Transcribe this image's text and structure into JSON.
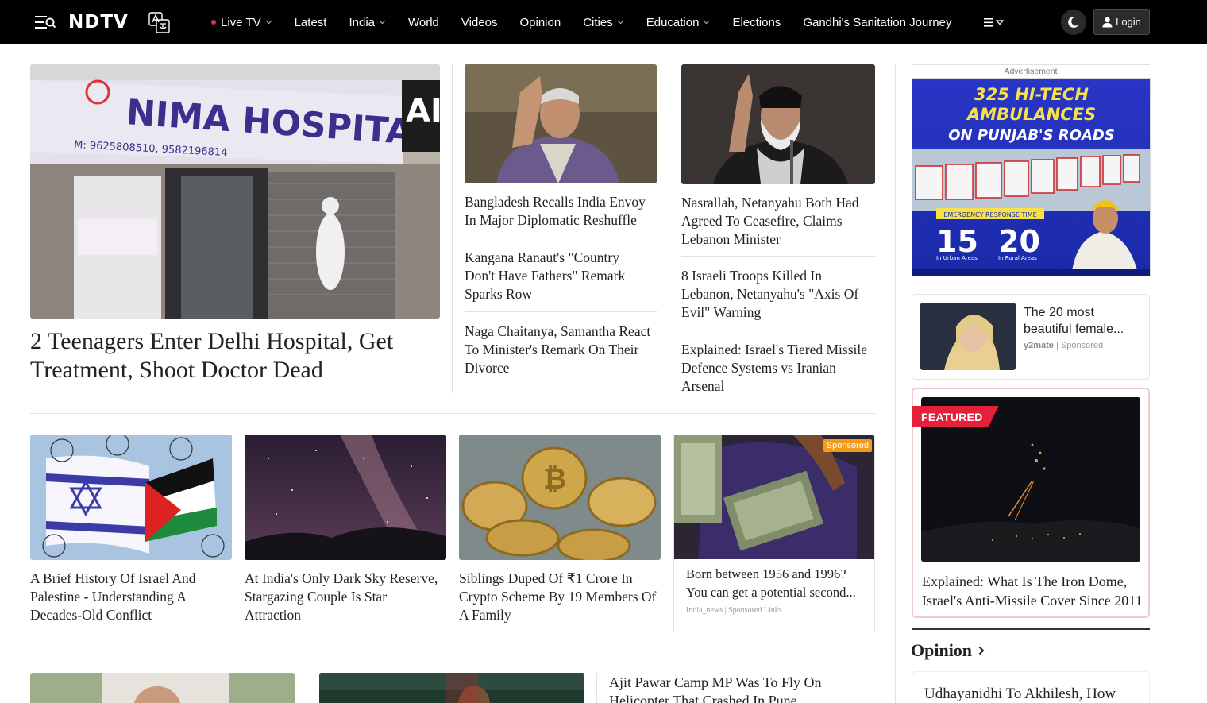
{
  "nav": {
    "logo": "NDTV",
    "links": [
      {
        "label": "Live TV",
        "dot": true,
        "chevron": true
      },
      {
        "label": "Latest",
        "chevron": false
      },
      {
        "label": "India",
        "chevron": true
      },
      {
        "label": "World",
        "chevron": false
      },
      {
        "label": "Videos",
        "chevron": false
      },
      {
        "label": "Opinion",
        "chevron": false
      },
      {
        "label": "Cities",
        "chevron": true
      },
      {
        "label": "Education",
        "chevron": true
      },
      {
        "label": "Elections",
        "chevron": false
      },
      {
        "label": "Gandhi's Sanitation Journey",
        "chevron": false
      }
    ],
    "login_label": "Login"
  },
  "hero": {
    "title": "2 Teenagers Enter Delhi Hospital, Get Treatment, Shoot Doctor Dead",
    "image_sign": "NIMA HOSPITAL",
    "image_phone": "M: 9625808510, 9582196814"
  },
  "col1": [
    "Bangladesh Recalls India Envoy In Major Diplomatic Reshuffle",
    "Kangana Ranaut's \"Country Don't Have Fathers\" Remark Sparks Row",
    "Naga Chaitanya, Samantha React To Minister's Remark On Their Divorce"
  ],
  "col2": [
    "Nasrallah, Netanyahu Both Had Agreed To Ceasefire, Claims Lebanon Minister",
    "8 Israeli Troops Killed In Lebanon, Netanyahu's \"Axis Of Evil\" Warning",
    "Explained: Israel's Tiered Missile Defence Systems vs Iranian Arsenal"
  ],
  "cards": [
    "A Brief History Of Israel And Palestine - Understanding A Decades-Old Conflict",
    "At India's Only Dark Sky Reserve, Stargazing Couple Is Star Attraction",
    "Siblings Duped Of ₹1 Crore In Crypto Scheme By 19 Members Of A Family"
  ],
  "sponsored": {
    "badge": "Sponsored",
    "title": "Born between 1956 and 1996? You can get a potential second...",
    "source": "India_news",
    "tag": "Sponsored Links"
  },
  "rail": {
    "ad_label": "Advertisement",
    "ad_line1": "325 HI-TECH",
    "ad_line2": "AMBULANCES",
    "ad_line3": "ON PUNJAB'S ROADS",
    "ad_response": "EMERGENCY RESPONSE TIME",
    "ad_urban_value": "15",
    "ad_urban_label": "In Urban Areas",
    "ad_rural_value": "20",
    "ad_rural_label": "In Rural Areas",
    "y2_title": "The 20 most beautiful female...",
    "y2_source": "y2mate",
    "y2_tag": "Sponsored",
    "featured_badge": "FEATURED",
    "featured_title": "Explained: What Is The Iron Dome, Israel's Anti-Missile Cover Since 2011",
    "opinion_heading": "Opinion",
    "opinion_first": "Udhayanidhi To Akhilesh, How"
  },
  "bottom": {
    "title": "Ajit Pawar Camp MP Was To Fly On Helicopter That Crashed In Pune"
  },
  "colors": {
    "accent": "#e5203a",
    "nav_bg": "#000000",
    "live_dot": "#e52e4d"
  }
}
